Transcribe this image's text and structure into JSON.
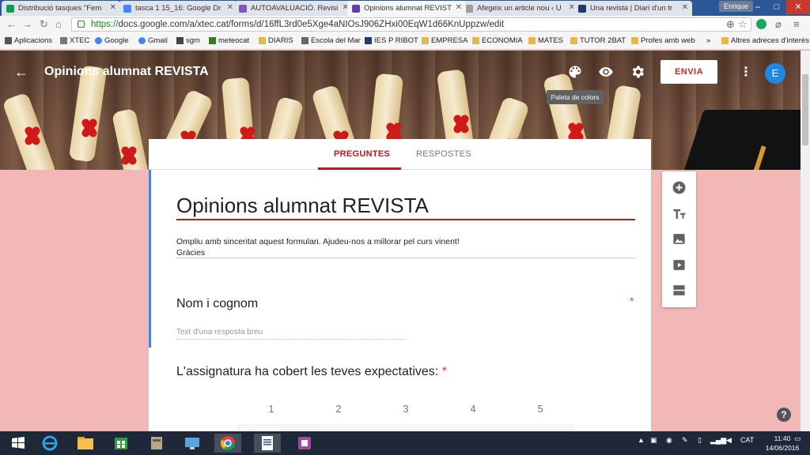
{
  "browser": {
    "tabs": [
      {
        "title": "Distribució tasques \"Fem",
        "icon": "sheets-icon",
        "color": "#0f9d58"
      },
      {
        "title": "tasca 1 15_16: Google Dr",
        "icon": "drive-icon",
        "color": "#4285f4"
      },
      {
        "title": "AUTOAVALUACIÓ. Revisi",
        "icon": "forms-icon",
        "color": "#7e57c2"
      },
      {
        "title": "Opinions alumnat REVIST",
        "icon": "forms-icon",
        "color": "#673ab7"
      },
      {
        "title": "Afegeix un article nou ‹ U",
        "icon": "page-icon",
        "color": "#9e9e9e"
      },
      {
        "title": "Una revista | Diari d'un tr",
        "icon": "x-icon",
        "color": "#1f3a6e"
      }
    ],
    "user": "Enrique",
    "url_proto": "https://",
    "url_rest": "docs.google.com/a/xtec.cat/forms/d/16ffL3rd0e5Xge4aNIOsJ906ZHxi00EqW1d66KnUppzw/edit",
    "bookmarks": [
      "Aplicacions",
      "XTEC",
      "Google",
      "Gmail",
      "sgm",
      "meteocat",
      "DIARIS",
      "Escola del Mar",
      "IES P RIBOT",
      "EMPRESA",
      "ECONOMIA",
      "MATES",
      "TUTOR 2BAT",
      "Profes amb web"
    ],
    "bookmarks_more": "»",
    "other_bookmarks": "Altres adreces d'interès"
  },
  "header": {
    "title": "Opinions alumnat REVISTA",
    "send_label": "ENVIA",
    "avatar_letter": "E",
    "tooltip": "Paleta de colors"
  },
  "tabs": {
    "questions": "PREGUNTES",
    "responses": "RESPOSTES"
  },
  "form": {
    "title": "Opinions alumnat REVISTA",
    "description_line1": "Ompliu amb sinceritat aquest formulari. Ajudeu-nos a millorar pel curs vinent!",
    "description_line2": "Gràcies",
    "q1_title": "Nom i cognom",
    "q1_placeholder": "Text d'una resposta breu",
    "required_mark": "*",
    "q2_title": "L'assignatura ha cobert les teves expectatives:",
    "scale": [
      "1",
      "2",
      "3",
      "4",
      "5"
    ]
  },
  "help_label": "?",
  "taskbar": {
    "lang": "CAT",
    "time": "11:40",
    "date": "14/06/2016"
  },
  "colors": {
    "accent": "#b71c1c",
    "page_bg": "#f2b8b8",
    "avatar": "#1e88e5"
  }
}
